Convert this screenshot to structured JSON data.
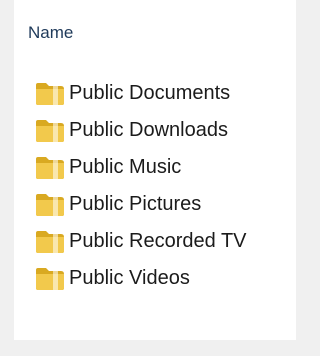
{
  "list": {
    "column_header": "Name",
    "items": [
      {
        "label": "Public Documents",
        "icon": "folder-icon"
      },
      {
        "label": "Public Downloads",
        "icon": "folder-icon"
      },
      {
        "label": "Public Music",
        "icon": "folder-icon"
      },
      {
        "label": "Public Pictures",
        "icon": "folder-icon"
      },
      {
        "label": "Public Recorded TV",
        "icon": "folder-icon"
      },
      {
        "label": "Public Videos",
        "icon": "folder-icon"
      }
    ]
  },
  "colors": {
    "window_background": "#f0f0f0",
    "pane_background": "#ffffff",
    "header_text": "#1f3a5a",
    "item_text": "#1b1b1b",
    "folder_yellow": "#f2c94c"
  }
}
